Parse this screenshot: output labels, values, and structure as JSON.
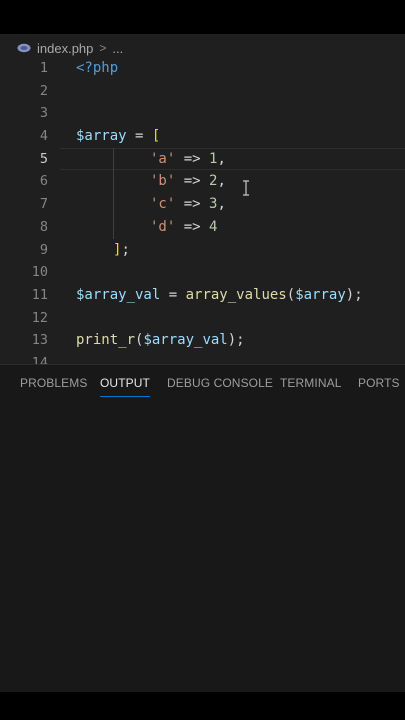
{
  "breadcrumb": {
    "icon": "php-elephant-icon",
    "file": "index.php",
    "separator": ">",
    "more": "..."
  },
  "editor": {
    "active_line": 5,
    "lines": [
      {
        "num": "1",
        "text": "<?php"
      },
      {
        "num": "2",
        "text": ""
      },
      {
        "num": "3",
        "text": ""
      },
      {
        "num": "4",
        "text": "$array = ["
      },
      {
        "num": "5",
        "text": "'a' => 1,"
      },
      {
        "num": "6",
        "text": "'b' => 2,"
      },
      {
        "num": "7",
        "text": "'c' => 3,"
      },
      {
        "num": "8",
        "text": "'d' => 4"
      },
      {
        "num": "9",
        "text": "];"
      },
      {
        "num": "10",
        "text": ""
      },
      {
        "num": "11",
        "text": "$array_val = array_values($array);"
      },
      {
        "num": "12",
        "text": ""
      },
      {
        "num": "13",
        "text": "print_r($array_val);"
      },
      {
        "num": "14",
        "text": ""
      }
    ]
  },
  "panel": {
    "tabs": [
      {
        "label": "PROBLEMS",
        "active": false
      },
      {
        "label": "OUTPUT",
        "active": true
      },
      {
        "label": "DEBUG CONSOLE",
        "active": false
      },
      {
        "label": "TERMINAL",
        "active": false
      },
      {
        "label": "PORTS",
        "active": false
      }
    ]
  },
  "colors": {
    "editor_bg": "#1f1f1f",
    "panel_bg": "#181818",
    "accent": "#0078d4",
    "keyword": "#569cd6",
    "variable": "#9cdcfe",
    "string": "#ce9178",
    "number": "#b5cea8",
    "function": "#dcdcaa",
    "bracket": "#ffd700"
  }
}
